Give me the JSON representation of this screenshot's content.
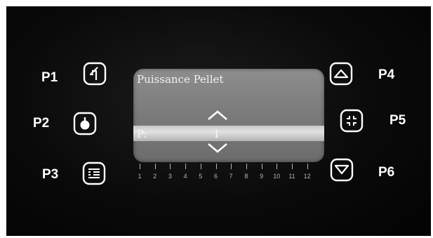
{
  "buttons": {
    "p1": {
      "label": "P1",
      "icon": "back-icon"
    },
    "p2": {
      "label": "P2",
      "icon": "power-icon"
    },
    "p3": {
      "label": "P3",
      "icon": "menu-icon"
    },
    "p4": {
      "label": "P4",
      "icon": "up-triangle-icon"
    },
    "p5": {
      "label": "P5",
      "icon": "collapse-icon"
    },
    "p6": {
      "label": "P6",
      "icon": "down-triangle-icon"
    }
  },
  "display": {
    "title": "Puissance Pellet",
    "param_label": "P:",
    "param_value": "1",
    "up_arrow": "chevron-up-icon",
    "down_arrow": "chevron-down-icon"
  },
  "scale": {
    "labels": [
      "1",
      "2",
      "3",
      "4",
      "5",
      "6",
      "7",
      "8",
      "9",
      "10",
      "11",
      "12"
    ],
    "current": 1
  },
  "colors": {
    "panel": "#0a0a0a",
    "lcd": "#7c7c7c",
    "lcd_highlight": "#d9d9d9",
    "icon": "#ffffff",
    "scale": "#b4b4b4"
  }
}
